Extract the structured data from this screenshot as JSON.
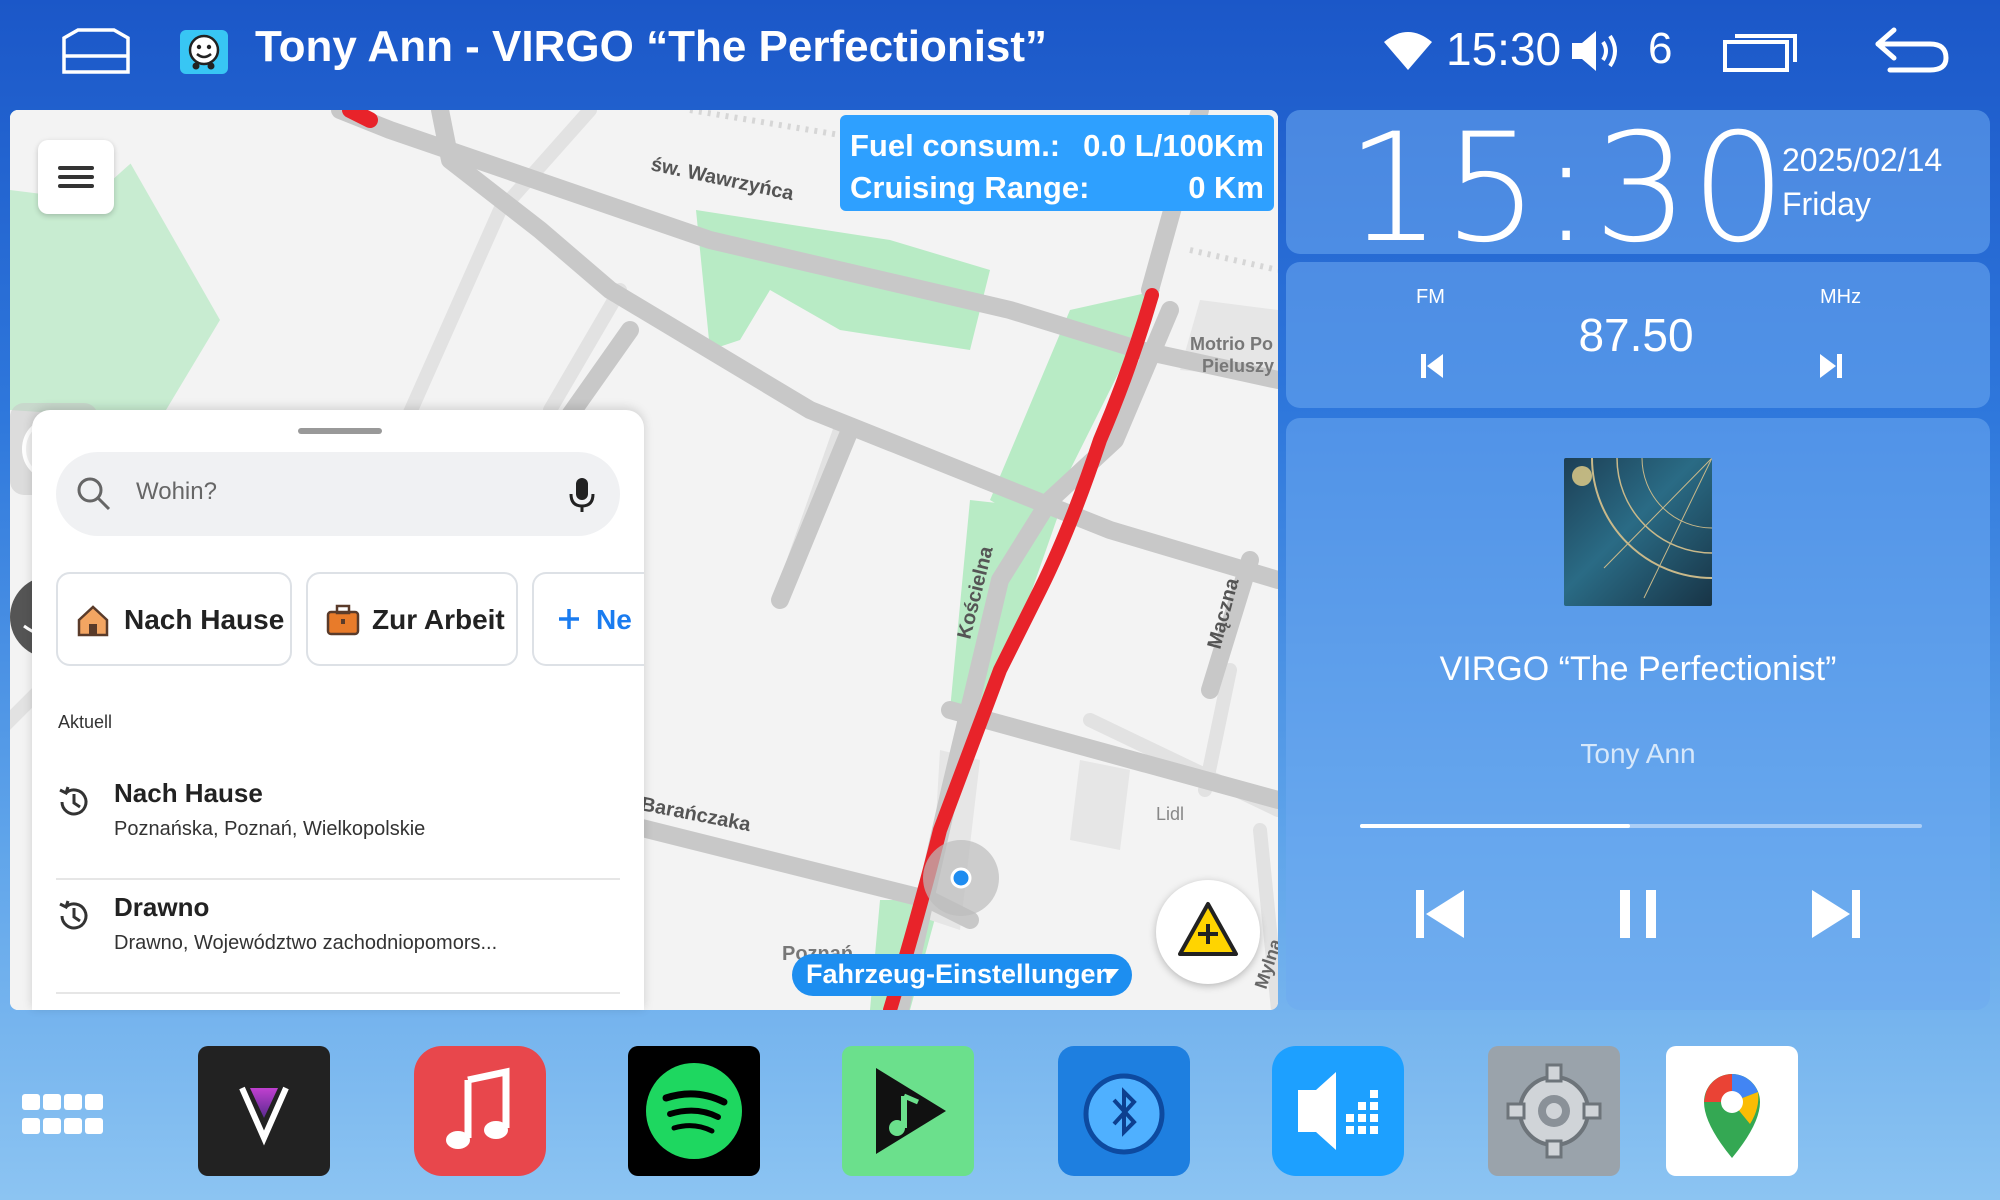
{
  "status_bar": {
    "title": "Tony Ann - VIRGO “The Perfectionist”",
    "time": "15:30",
    "volume": "6",
    "icons": [
      "home-icon",
      "waze-icon",
      "wifi-icon",
      "volume-icon",
      "recents-icon",
      "back-icon"
    ]
  },
  "map": {
    "fuel_label": "Fuel consum.:",
    "fuel_value": "0.0 L/100Km",
    "range_label": "Cruising Range:",
    "range_value": "0 Km",
    "streets": [
      "św. Wawrzyńca",
      "Kościelna",
      "Mączna",
      "Barańczaka",
      "Lidl",
      "Motrio Po",
      "Pieluszy",
      "Poznań",
      "Mylna"
    ],
    "vehicle_settings": "Fahrzeug-Einstellungen",
    "route_color": "#e8232a"
  },
  "search_panel": {
    "placeholder": "Wohin?",
    "chips": [
      {
        "label": "Nach Hause",
        "icon": "house-icon"
      },
      {
        "label": "Zur Arbeit",
        "icon": "briefcase-icon"
      },
      {
        "label": "Ne",
        "icon": "plus-icon"
      }
    ],
    "section_label": "Aktuell",
    "recents": [
      {
        "title": "Nach Hause",
        "subtitle": "Poznańska, Poznań, Wielkopolskie"
      },
      {
        "title": "Drawno",
        "subtitle": "Drawno, Województwo zachodniopomors..."
      }
    ]
  },
  "clock": {
    "time": "15:30",
    "date": "2025/02/14",
    "day": "Friday"
  },
  "radio": {
    "band": "FM",
    "frequency": "87.50",
    "unit": "MHz"
  },
  "music": {
    "song": "VIRGO “The Perfectionist”",
    "artist": "Tony Ann",
    "progress": 0.48
  },
  "dock": {
    "apps": [
      {
        "name": "V",
        "color": "#222222"
      },
      {
        "name": "music",
        "color": "#e8474c"
      },
      {
        "name": "spotify",
        "color": "#000000"
      },
      {
        "name": "play-music",
        "color": "#6be08c"
      },
      {
        "name": "bluetooth",
        "color": "#1e7fe0"
      },
      {
        "name": "equalizer",
        "color": "#1da0ff"
      },
      {
        "name": "settings",
        "color": "#9aa3ab"
      },
      {
        "name": "maps",
        "color": "#ffffff"
      }
    ]
  },
  "colors": {
    "accent": "#2ea0ff",
    "route": "#e8232a"
  }
}
